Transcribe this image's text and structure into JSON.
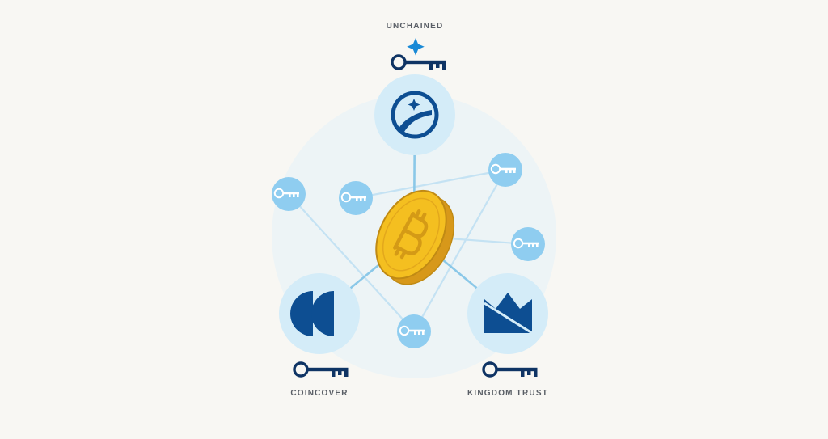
{
  "labels": {
    "top": "UNCHAINED",
    "left": "COINCOVER",
    "right": "KINGDOM TRUST"
  },
  "colors": {
    "background": "#f8f7f3",
    "halo": "#edf4f6",
    "bubble_large": "#d4ecf8",
    "bubble_small": "#8fcdf0",
    "connector": "#c4e2f3",
    "connector_strong": "#8bc8e8",
    "navy": "#0f3464",
    "brand_blue": "#0d4e92",
    "sparkle": "#1a8ad6",
    "coin": "#f4bf20",
    "coin_edge": "#d7981a",
    "coin_stroke": "#c08a14"
  },
  "icons": {
    "center": "bitcoin-coin-icon",
    "unchained": "unchained-logo-icon",
    "coincover": "coincover-logo-icon",
    "kingdom_trust": "kingdom-trust-logo-icon",
    "key": "key-icon",
    "sparkle": "sparkle-icon"
  }
}
